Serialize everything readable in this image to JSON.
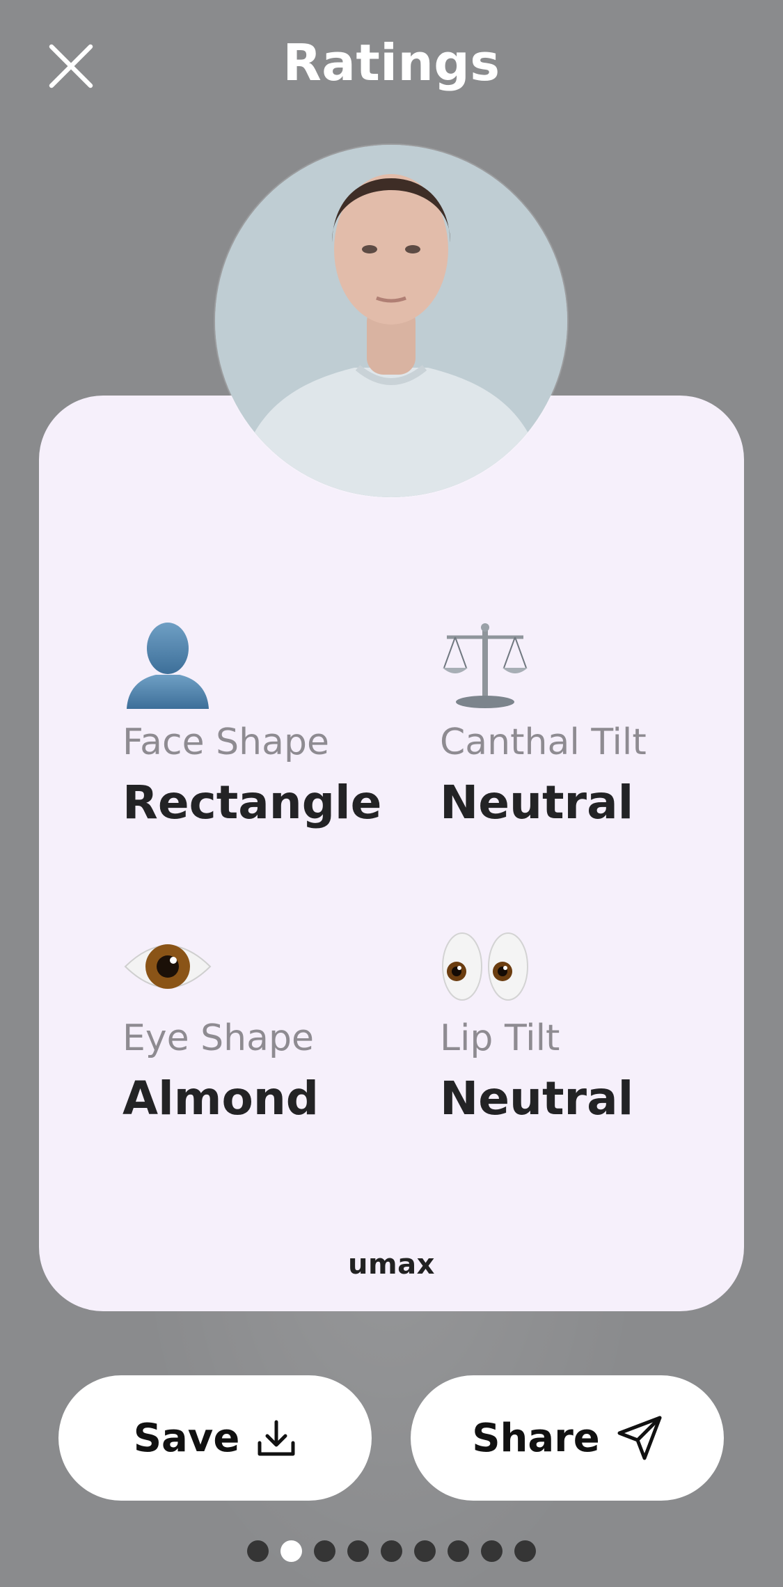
{
  "header": {
    "title": "Ratings",
    "close_icon": "close-icon"
  },
  "card": {
    "metrics": [
      {
        "icon": "silhouette-emoji",
        "label": "Face Shape",
        "value": "Rectangle"
      },
      {
        "icon": "balance-scale-emoji",
        "label": "Canthal Tilt",
        "value": "Neutral"
      },
      {
        "icon": "eye-emoji",
        "label": "Eye Shape",
        "value": "Almond"
      },
      {
        "icon": "eyes-emoji",
        "label": "Lip Tilt",
        "value": "Neutral"
      }
    ],
    "brand": "umax"
  },
  "actions": {
    "save_label": "Save",
    "share_label": "Share"
  },
  "pagination": {
    "count": 9,
    "active_index": 1
  },
  "colors": {
    "background": "#8a8b8d",
    "card": "#f6f0fb",
    "active_dot": "#ffffff",
    "inactive_dot": "#353535"
  }
}
